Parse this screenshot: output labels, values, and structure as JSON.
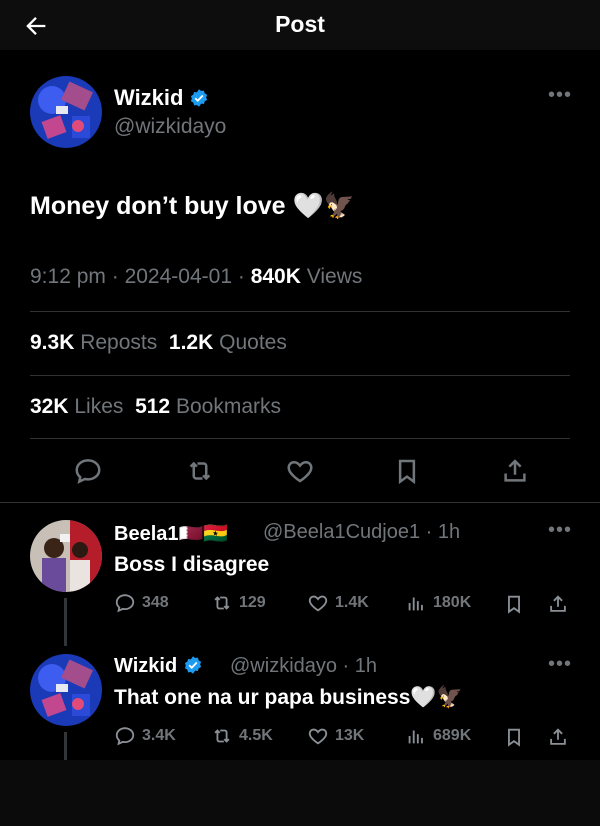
{
  "header": {
    "title": "Post"
  },
  "post": {
    "author_name": "Wizkid",
    "handle": "@wizkidayo",
    "text": "Money don’t buy love 🤍🦅",
    "time": "9:12 pm",
    "date": "2024-04-01",
    "views_count": "840K",
    "views_label": "Views",
    "reposts_count": "9.3K",
    "reposts_label": "Reposts",
    "quotes_count": "1.2K",
    "quotes_label": "Quotes",
    "likes_count": "32K",
    "likes_label": "Likes",
    "bookmarks_count": "512",
    "bookmarks_label": "Bookmarks"
  },
  "replies": [
    {
      "author_name": "Beela1🇶🇦🇬🇭",
      "handle": "@Beela1Cudjoe1 · 1h",
      "text": "Boss I disagree",
      "replies": "348",
      "reposts": "129",
      "likes": "1.4K",
      "views": "180K"
    },
    {
      "author_name": "Wizkid",
      "handle": "@wizkidayo · 1h",
      "text": "That one na ur papa business🤍🦅",
      "replies": "3.4K",
      "reposts": "4.5K",
      "likes": "13K",
      "views": "689K"
    }
  ],
  "colors": {
    "background": "#000000",
    "muted": "#71767b",
    "verified": "#1d9bf0",
    "divider": "#2f3336"
  }
}
